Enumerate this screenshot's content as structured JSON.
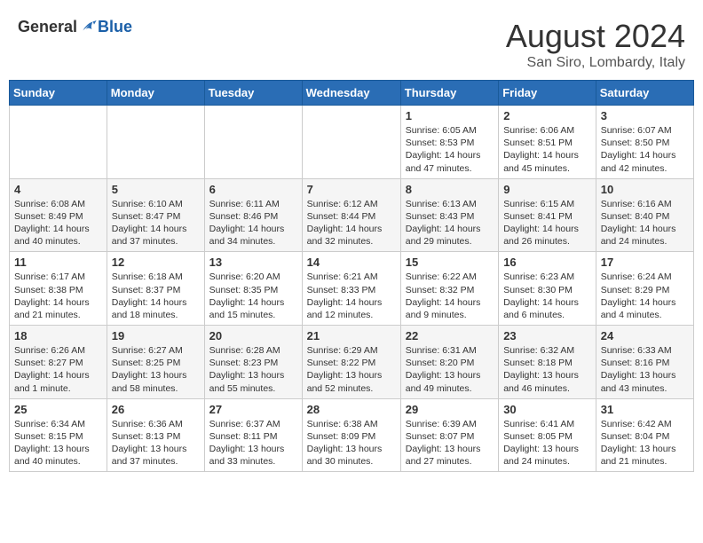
{
  "header": {
    "logo_general": "General",
    "logo_blue": "Blue",
    "month_title": "August 2024",
    "location": "San Siro, Lombardy, Italy"
  },
  "weekdays": [
    "Sunday",
    "Monday",
    "Tuesday",
    "Wednesday",
    "Thursday",
    "Friday",
    "Saturday"
  ],
  "weeks": [
    [
      {
        "day": "",
        "info": ""
      },
      {
        "day": "",
        "info": ""
      },
      {
        "day": "",
        "info": ""
      },
      {
        "day": "",
        "info": ""
      },
      {
        "day": "1",
        "info": "Sunrise: 6:05 AM\nSunset: 8:53 PM\nDaylight: 14 hours and 47 minutes."
      },
      {
        "day": "2",
        "info": "Sunrise: 6:06 AM\nSunset: 8:51 PM\nDaylight: 14 hours and 45 minutes."
      },
      {
        "day": "3",
        "info": "Sunrise: 6:07 AM\nSunset: 8:50 PM\nDaylight: 14 hours and 42 minutes."
      }
    ],
    [
      {
        "day": "4",
        "info": "Sunrise: 6:08 AM\nSunset: 8:49 PM\nDaylight: 14 hours and 40 minutes."
      },
      {
        "day": "5",
        "info": "Sunrise: 6:10 AM\nSunset: 8:47 PM\nDaylight: 14 hours and 37 minutes."
      },
      {
        "day": "6",
        "info": "Sunrise: 6:11 AM\nSunset: 8:46 PM\nDaylight: 14 hours and 34 minutes."
      },
      {
        "day": "7",
        "info": "Sunrise: 6:12 AM\nSunset: 8:44 PM\nDaylight: 14 hours and 32 minutes."
      },
      {
        "day": "8",
        "info": "Sunrise: 6:13 AM\nSunset: 8:43 PM\nDaylight: 14 hours and 29 minutes."
      },
      {
        "day": "9",
        "info": "Sunrise: 6:15 AM\nSunset: 8:41 PM\nDaylight: 14 hours and 26 minutes."
      },
      {
        "day": "10",
        "info": "Sunrise: 6:16 AM\nSunset: 8:40 PM\nDaylight: 14 hours and 24 minutes."
      }
    ],
    [
      {
        "day": "11",
        "info": "Sunrise: 6:17 AM\nSunset: 8:38 PM\nDaylight: 14 hours and 21 minutes."
      },
      {
        "day": "12",
        "info": "Sunrise: 6:18 AM\nSunset: 8:37 PM\nDaylight: 14 hours and 18 minutes."
      },
      {
        "day": "13",
        "info": "Sunrise: 6:20 AM\nSunset: 8:35 PM\nDaylight: 14 hours and 15 minutes."
      },
      {
        "day": "14",
        "info": "Sunrise: 6:21 AM\nSunset: 8:33 PM\nDaylight: 14 hours and 12 minutes."
      },
      {
        "day": "15",
        "info": "Sunrise: 6:22 AM\nSunset: 8:32 PM\nDaylight: 14 hours and 9 minutes."
      },
      {
        "day": "16",
        "info": "Sunrise: 6:23 AM\nSunset: 8:30 PM\nDaylight: 14 hours and 6 minutes."
      },
      {
        "day": "17",
        "info": "Sunrise: 6:24 AM\nSunset: 8:29 PM\nDaylight: 14 hours and 4 minutes."
      }
    ],
    [
      {
        "day": "18",
        "info": "Sunrise: 6:26 AM\nSunset: 8:27 PM\nDaylight: 14 hours and 1 minute."
      },
      {
        "day": "19",
        "info": "Sunrise: 6:27 AM\nSunset: 8:25 PM\nDaylight: 13 hours and 58 minutes."
      },
      {
        "day": "20",
        "info": "Sunrise: 6:28 AM\nSunset: 8:23 PM\nDaylight: 13 hours and 55 minutes."
      },
      {
        "day": "21",
        "info": "Sunrise: 6:29 AM\nSunset: 8:22 PM\nDaylight: 13 hours and 52 minutes."
      },
      {
        "day": "22",
        "info": "Sunrise: 6:31 AM\nSunset: 8:20 PM\nDaylight: 13 hours and 49 minutes."
      },
      {
        "day": "23",
        "info": "Sunrise: 6:32 AM\nSunset: 8:18 PM\nDaylight: 13 hours and 46 minutes."
      },
      {
        "day": "24",
        "info": "Sunrise: 6:33 AM\nSunset: 8:16 PM\nDaylight: 13 hours and 43 minutes."
      }
    ],
    [
      {
        "day": "25",
        "info": "Sunrise: 6:34 AM\nSunset: 8:15 PM\nDaylight: 13 hours and 40 minutes."
      },
      {
        "day": "26",
        "info": "Sunrise: 6:36 AM\nSunset: 8:13 PM\nDaylight: 13 hours and 37 minutes."
      },
      {
        "day": "27",
        "info": "Sunrise: 6:37 AM\nSunset: 8:11 PM\nDaylight: 13 hours and 33 minutes."
      },
      {
        "day": "28",
        "info": "Sunrise: 6:38 AM\nSunset: 8:09 PM\nDaylight: 13 hours and 30 minutes."
      },
      {
        "day": "29",
        "info": "Sunrise: 6:39 AM\nSunset: 8:07 PM\nDaylight: 13 hours and 27 minutes."
      },
      {
        "day": "30",
        "info": "Sunrise: 6:41 AM\nSunset: 8:05 PM\nDaylight: 13 hours and 24 minutes."
      },
      {
        "day": "31",
        "info": "Sunrise: 6:42 AM\nSunset: 8:04 PM\nDaylight: 13 hours and 21 minutes."
      }
    ]
  ]
}
